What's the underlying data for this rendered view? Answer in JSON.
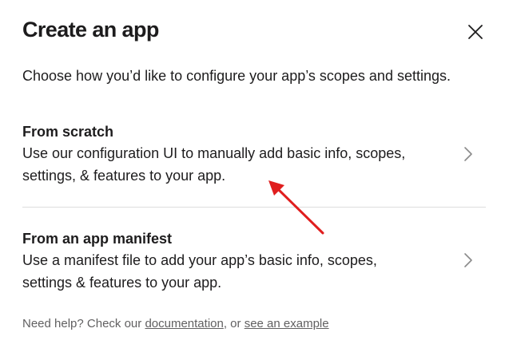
{
  "modal": {
    "title": "Create an app",
    "subtitle": "Choose how you’d like to configure your app’s scopes and settings."
  },
  "options": [
    {
      "title": "From scratch",
      "description": "Use our configuration UI to manually add basic info, scopes, settings, & features to your app."
    },
    {
      "title": "From an app manifest",
      "description": "Use a manifest file to add your app’s basic info, scopes, settings & features to your app."
    }
  ],
  "help": {
    "prefix": "Need help? Check our ",
    "documentation_link": "documentation",
    "middle": ", or ",
    "example_link": "see an example"
  },
  "icons": {
    "close": "close-icon",
    "chevron": "chevron-right-icon"
  },
  "colors": {
    "text": "#1d1c1d",
    "muted": "#616061",
    "divider": "#dddddd",
    "annotation_arrow": "#e01e1e"
  }
}
